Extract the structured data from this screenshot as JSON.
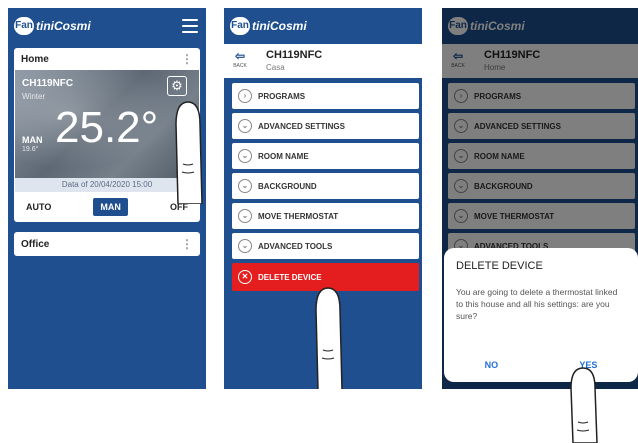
{
  "logo": {
    "badge": "Fan",
    "text": "tiniCosmi"
  },
  "phone1": {
    "home_label": "Home",
    "device_name": "CH119NFC",
    "season": "Winter",
    "temperature": "25.2°",
    "mode_label": "MAN",
    "setpoint": "19.6°",
    "data_timestamp": "Data of 20/04/2020 15:00",
    "modes": [
      "AUTO",
      "MAN",
      "OFF"
    ],
    "office_label": "Office"
  },
  "phone2": {
    "back_label": "BACK",
    "device_name": "CH119NFC",
    "location": "Casa",
    "menu": [
      "PROGRAMS",
      "ADVANCED SETTINGS",
      "ROOM NAME",
      "BACKGROUND",
      "MOVE THERMOSTAT",
      "ADVANCED TOOLS"
    ],
    "delete_label": "DELETE DEVICE"
  },
  "phone3": {
    "back_label": "BACK",
    "device_name": "CH119NFC",
    "location": "Home",
    "menu": [
      "PROGRAMS",
      "ADVANCED SETTINGS",
      "ROOM NAME",
      "BACKGROUND",
      "MOVE THERMOSTAT",
      "ADVANCED TOOLS"
    ],
    "dialog": {
      "title": "DELETE DEVICE",
      "message": "You are going to delete a thermostat linked to this house and all his settings: are you sure?",
      "no": "NO",
      "yes": "YES"
    }
  },
  "colors": {
    "brand_blue": "#1f4f8f",
    "delete_red": "#e41e1e",
    "link_blue": "#1f6fd8"
  },
  "icons": [
    "hamburger-icon",
    "gear-icon",
    "back-icon",
    "chevron-icon",
    "close-icon",
    "pointing-hand-icon"
  ]
}
